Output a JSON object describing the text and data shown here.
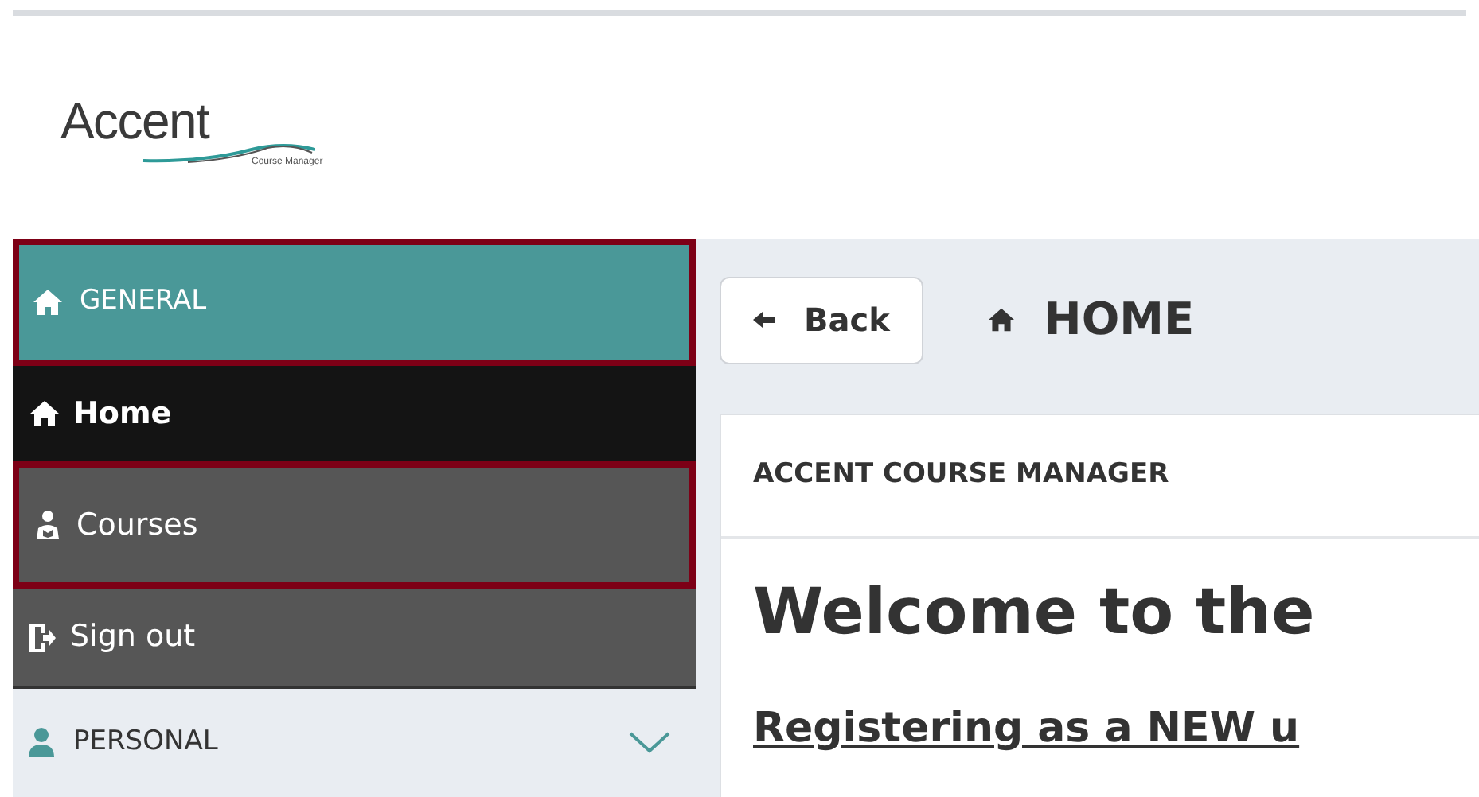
{
  "logo": {
    "name": "Accent",
    "tagline": "Course Manager"
  },
  "sidebar": {
    "sections": [
      {
        "label": "GENERAL",
        "kind": "home",
        "expanded": true,
        "highlighted": true,
        "items": [
          {
            "label": "Home",
            "kind": "home",
            "selected": true,
            "highlighted": false
          },
          {
            "label": "Courses",
            "kind": "courses",
            "selected": false,
            "highlighted": true
          },
          {
            "label": "Sign out",
            "kind": "signout",
            "selected": false,
            "highlighted": false
          }
        ]
      },
      {
        "label": "PERSONAL",
        "kind": "person",
        "expanded": false,
        "highlighted": false
      }
    ]
  },
  "toolbar": {
    "back_button": "Back",
    "page_title": "HOME"
  },
  "card": {
    "header": "ACCENT COURSE MANAGER",
    "heading": "Welcome to the",
    "link": "Registering as a NEW u"
  }
}
